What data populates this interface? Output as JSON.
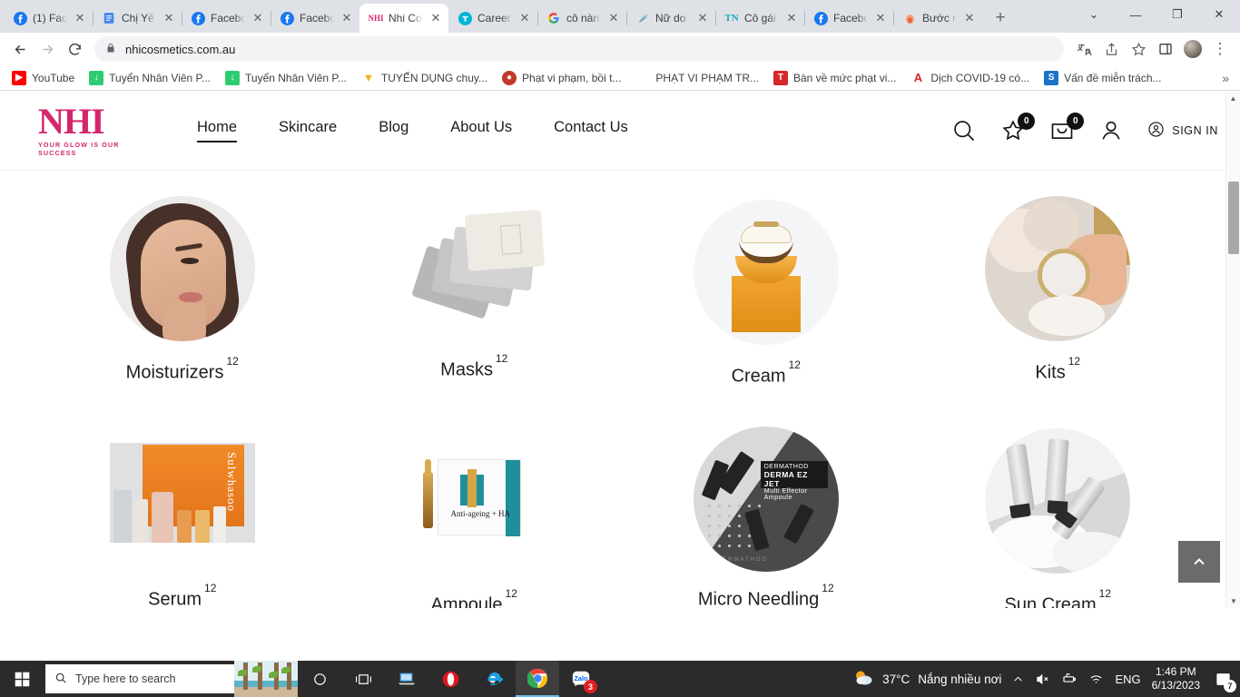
{
  "browser": {
    "tabs": [
      {
        "title": "(1) Fac",
        "favicon": "facebook-icon",
        "active": false
      },
      {
        "title": "Chị Yế",
        "favicon": "google-docs-icon",
        "active": false
      },
      {
        "title": "Facebo",
        "favicon": "facebook-icon",
        "active": false
      },
      {
        "title": "Facebo",
        "favicon": "facebook-icon",
        "active": false
      },
      {
        "title": "Nhi Co",
        "favicon": "nhi-cosmetics-icon",
        "active": true
      },
      {
        "title": "Career",
        "favicon": "topcv-icon",
        "active": false
      },
      {
        "title": "cô nàn",
        "favicon": "google-icon",
        "active": false
      },
      {
        "title": "Nữ do",
        "favicon": "bird-icon",
        "active": false
      },
      {
        "title": "Cô gái",
        "favicon": "tn-icon",
        "active": false
      },
      {
        "title": "Facebo",
        "favicon": "facebook-icon",
        "active": false
      },
      {
        "title": "Bước n",
        "favicon": "flame-icon",
        "active": false
      }
    ],
    "new_tab_label": "+",
    "tab_search_label": "⌄",
    "window_controls": {
      "minimize": "—",
      "maximize": "❐",
      "close": "✕"
    },
    "toolbar": {
      "back": "←",
      "forward": "→",
      "reload": "⟳",
      "lock_icon": "lock-icon",
      "url": "nhicosmetics.com.au",
      "translate": "translate-icon",
      "share": "share-icon",
      "bookmark": "star-icon",
      "sidepanel": "side-panel-icon",
      "profile": "profile-avatar",
      "menu": "⋮"
    },
    "bookmarks": [
      {
        "label": "YouTube",
        "icon": "youtube-icon"
      },
      {
        "label": "Tuyển Nhân Viên P...",
        "icon": "green-doc-icon"
      },
      {
        "label": "Tuyển Nhân Viên P...",
        "icon": "green-doc-icon"
      },
      {
        "label": "TUYỂN DỤNG chuy...",
        "icon": "yellow-bird-icon"
      },
      {
        "label": "Phạt vi phạm, bồi t...",
        "icon": "red-seal-icon"
      },
      {
        "label": "PHẠT VI PHẠM TR...",
        "icon": "blank-icon"
      },
      {
        "label": "Bàn về mức phạt vi...",
        "icon": "red-tapchi-icon"
      },
      {
        "label": "Dịch COVID-19 có...",
        "icon": "red-a-icon"
      },
      {
        "label": "Vấn đề miễn trách...",
        "icon": "blue-s-icon"
      }
    ],
    "bookmarks_overflow": "»"
  },
  "site": {
    "logo": {
      "mark": "NHI",
      "tagline": "YOUR GLOW IS OUR SUCCESS",
      "color": "#d4266e"
    },
    "nav": [
      {
        "label": "Home",
        "active": true
      },
      {
        "label": "Skincare",
        "active": false
      },
      {
        "label": "Blog",
        "active": false
      },
      {
        "label": "About Us",
        "active": false
      },
      {
        "label": "Contact Us",
        "active": false
      }
    ],
    "actions": {
      "search_icon": "search-icon",
      "wishlist_icon": "star-icon",
      "wishlist_count": "0",
      "cart_icon": "shopping-bag-icon",
      "cart_count": "0",
      "account_icon": "user-icon",
      "signin_label": "SIGN IN",
      "signin_icon": "user-circle-icon"
    },
    "categories": [
      {
        "label": "Moisturizers",
        "count": "12",
        "image": "woman-face-photo"
      },
      {
        "label": "Masks",
        "count": "12",
        "image": "sheet-mask-sachets-photo"
      },
      {
        "label": "Cream",
        "count": "12",
        "image": "sulwhasoo-orange-jar-photo"
      },
      {
        "label": "Kits",
        "count": "12",
        "image": "cushion-compact-flowers-photo"
      },
      {
        "label": "Serum",
        "count": "12",
        "image": "sulwhasoo-serum-set-photo"
      },
      {
        "label": "Ampoule",
        "count": "12",
        "image": "toskani-anti-ageing-ha-box-photo"
      },
      {
        "label": "Micro Needling",
        "count": "12",
        "image": "dermathod-derma-ez-jet-photo"
      },
      {
        "label": "Sun Cream",
        "count": "12",
        "image": "sunscreen-tubes-clouds-photo"
      }
    ],
    "back_to_top": "back-to-top-button",
    "ampoule_product_text": "Anti-ageing + HA",
    "mn_label_brand": "DERMATHOD",
    "mn_label_title": "DERMA EZ JET",
    "mn_label_sub": "Multi Effector Ampoule",
    "mn_watermark": "DERMATHOD",
    "serum_brand": "Sulwhasoo"
  },
  "taskbar": {
    "start_icon": "windows-start-icon",
    "search_placeholder": "Type here to search",
    "search_icon": "search-icon",
    "apps": [
      {
        "name": "cortana-icon"
      },
      {
        "name": "task-view-icon"
      },
      {
        "name": "this-pc-icon"
      },
      {
        "name": "opera-icon"
      },
      {
        "name": "internet-explorer-icon"
      },
      {
        "name": "google-chrome-icon",
        "active": true
      },
      {
        "name": "zalo-icon",
        "badge": "3"
      }
    ],
    "tray": {
      "weather_icon": "partly-cloudy-icon",
      "temperature": "37°C",
      "condition": "Nắng nhiều nơi",
      "chevron_up": "show-hidden-icons",
      "volume_icon": "volume-muted-icon",
      "battery_icon": "battery-icon",
      "wifi_icon": "wifi-icon",
      "language": "ENG",
      "time": "1:46 PM",
      "date": "6/13/2023",
      "notification_icon": "action-center-icon",
      "notification_count": "7"
    }
  }
}
